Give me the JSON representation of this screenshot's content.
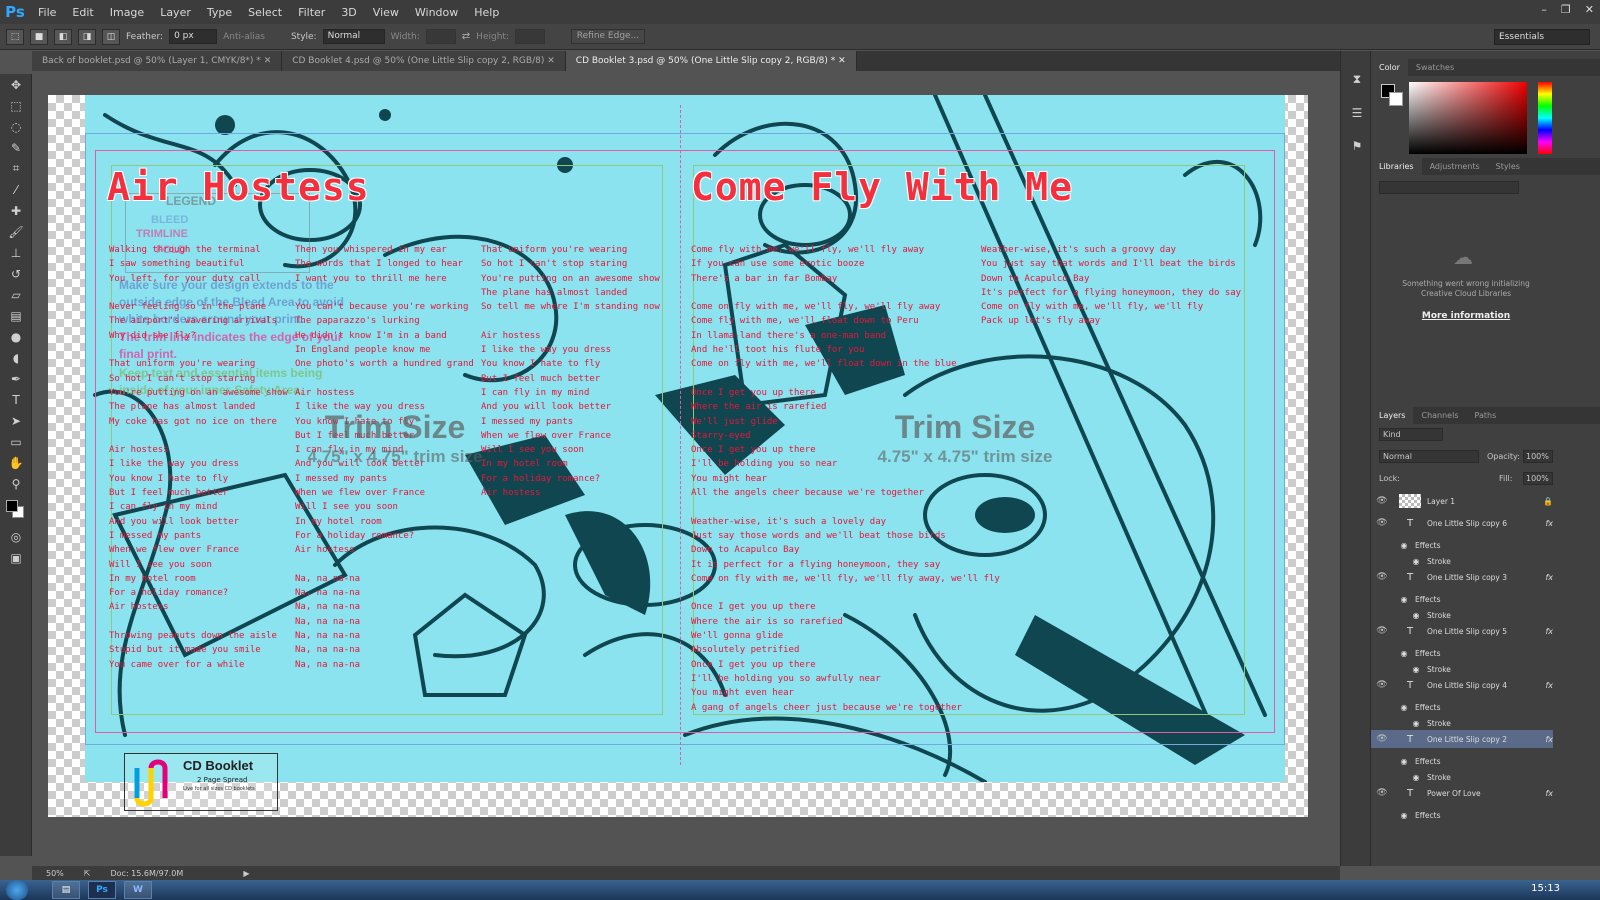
{
  "app": {
    "logo": "Ps",
    "menu": [
      "File",
      "Edit",
      "Image",
      "Layer",
      "Type",
      "Select",
      "Filter",
      "3D",
      "View",
      "Window",
      "Help"
    ]
  },
  "options": {
    "feather_label": "Feather:",
    "feather_value": "0 px",
    "antialias": "Anti-alias",
    "style_label": "Style:",
    "style_value": "Normal",
    "width_label": "Width:",
    "height_label": "Height:",
    "refine": "Refine Edge...",
    "workspace": "Essentials"
  },
  "tabs": [
    {
      "label": "Back of booklet.psd @ 50% (Layer 1, CMYK/8*) *"
    },
    {
      "label": "CD Booklet 4.psd @ 50% (One Little Slip copy 2, RGB/8)"
    },
    {
      "label": "CD Booklet 3.psd @ 50% (One Little Slip copy 2, RGB/8) *"
    }
  ],
  "document": {
    "title_left": "Air Hostess",
    "title_right": "Come Fly With Me",
    "col1": "Walking through the terminal\nI saw something beautiful\nYou left, for your duty call\n\nNever feeling so in the plane\nThe airport's wavering arrivals\nWhy did she fly?\n\nThat uniform you're wearing\nSo hot I can't stop staring\nYou're putting on an awesome show\nThe plane has almost landed\nMy coke has got no ice on there\n\nAir hostess\nI like the way you dress\nYou know I hate to fly\nBut I feel much better\nI can fly in my mind\nAnd you will look better\nI messed my pants\nWhen we flew over France\nWill I see you soon\nIn my hotel room\nFor a holiday romance?\nAir hostess\n\nThrowing peanuts down the aisle\nStupid but it made you smile\nYou came over for a while",
    "col2": "Then you whispered in my ear\nThe words that I longed to hear\nI want you to thrill me here\n\nYou can't because you're working\nThe paparazzo's lurking\nHe didn't know I'm in a band\nIn England people know me\nOne photo's worth a hundred grand\n\nAir hostess\nI like the way you dress\nYou know I hate to fly\nBut I feel much better\nI can fly in my mind\nAnd you will look better\nI messed my pants\nWhen we flew over France\nWill I see you soon\nIn my hotel room\nFor a holiday romance?\nAir hostess\n\nNa, na na-na\nNa, na na-na\nNa, na na-na\nNa, na na-na\nNa, na na-na\nNa, na na-na\nNa, na na-na",
    "col3": "That uniform you're wearing\nSo hot I can't stop staring\nYou're putting on an awesome show\nThe plane has almost landed\nSo tell me where I'm standing now\n\nAir hostess\nI like the way you dress\nYou know I hate to fly\nBut I feel much better\nI can fly in my mind\nAnd you will look better\nI messed my pants\nWhen we flew over France\nWill I see you soon\nIn my hotel room\nFor a holiday romance?\nAir hostess",
    "col4": "Come fly with me, we'll fly, we'll fly away\nIf you can use some erotic booze\nThere's a bar in far Bombay\n\nCome on fly with me, we'll fly, we'll fly away\nCome fly with me, we'll float down to Peru\nIn llama-land there's a one-man band\nAnd he'll toot his flute for you\nCome on fly with me, we'll float down in the blue\n\nOnce I get you up there\nWhere the air is rarefied\nWe'll just glide\nStarry-eyed\nOnce I get you up there\nI'll be holding you so near\nYou might hear\nAll the angels cheer because we're together\n\nWeather-wise, it's such a lovely day\nJust say those words and we'll beat those birds\nDown to Acapulco Bay\nIt is perfect for a flying honeymoon, they say\nCome on fly with me, we'll fly, we'll fly away, we'll fly\n\nOnce I get you up there\nWhere the air is so rarefied\nWe'll gonna glide\nAbsolutely petrified\nOnce I get you up there\nI'll be holding you so awfully near\nYou might even hear\nA gang of angels cheer just because we're together",
    "col5": "Weather-wise, it's such a groovy day\nYou just say that words and I'll beat the birds\nDown to Acapulco Bay\nIt's perfect for a flying honeymoon, they do say\nCome on fly with me, we'll fly, we'll fly\nPack up let's fly away",
    "trim_title": "Trim Size",
    "trim_sub": "4.75\" x 4.75\" trim size",
    "legend": {
      "title": "LEGEND",
      "bleed": "BLEED",
      "trimline": "TRIMLINE",
      "fold": "FOLD"
    },
    "notes": [
      "Make sure your design extends to the outside edge of the Bleed Area to avoid white borders around your print.",
      "The trim line indicates the edge of your final print.",
      "Keep text and essential items being inside of your inner-Safety Area."
    ],
    "logo_title": "CD Booklet",
    "logo_sub": "2 Page Spread",
    "logo_small": "Live for all sizes CD booklets"
  },
  "panels": {
    "color_tabs": [
      "Color",
      "Swatches"
    ],
    "lib_tabs": [
      "Libraries",
      "Adjustments",
      "Styles"
    ],
    "lib_error": "Something went wrong initializing Creative Cloud Libraries",
    "lib_link": "More information",
    "layer_tabs": [
      "Layers",
      "Channels",
      "Paths"
    ],
    "kind": "Kind",
    "blend": "Normal",
    "opacity_label": "Opacity:",
    "opacity": "100%",
    "lock_label": "Lock:",
    "fill_label": "Fill:",
    "fill": "100%",
    "layers": [
      {
        "name": "Layer 1",
        "type": "pixel"
      },
      {
        "name": "One Little Slip copy 6",
        "type": "text"
      },
      {
        "name": "Effects",
        "type": "effects"
      },
      {
        "name": "Stroke",
        "type": "stroke"
      },
      {
        "name": "One Little Slip copy 3",
        "type": "text"
      },
      {
        "name": "Effects",
        "type": "effects"
      },
      {
        "name": "Stroke",
        "type": "stroke"
      },
      {
        "name": "One Little Slip copy 5",
        "type": "text"
      },
      {
        "name": "Effects",
        "type": "effects"
      },
      {
        "name": "Stroke",
        "type": "stroke"
      },
      {
        "name": "One Little Slip copy 4",
        "type": "text"
      },
      {
        "name": "Effects",
        "type": "effects"
      },
      {
        "name": "Stroke",
        "type": "stroke"
      },
      {
        "name": "One Little Slip copy 2",
        "type": "text"
      },
      {
        "name": "Effects",
        "type": "effects"
      },
      {
        "name": "Stroke",
        "type": "stroke"
      },
      {
        "name": "Power Of Love",
        "type": "text"
      },
      {
        "name": "Effects",
        "type": "effects"
      }
    ]
  },
  "status": {
    "zoom": "50%",
    "doc": "Doc: 15.6M/97.0M"
  },
  "taskbar": {
    "clock": "15:13"
  },
  "colors": {
    "accent": "#31a8ff",
    "lyrics": "#e8163a",
    "paper": "#8ae3ee"
  }
}
